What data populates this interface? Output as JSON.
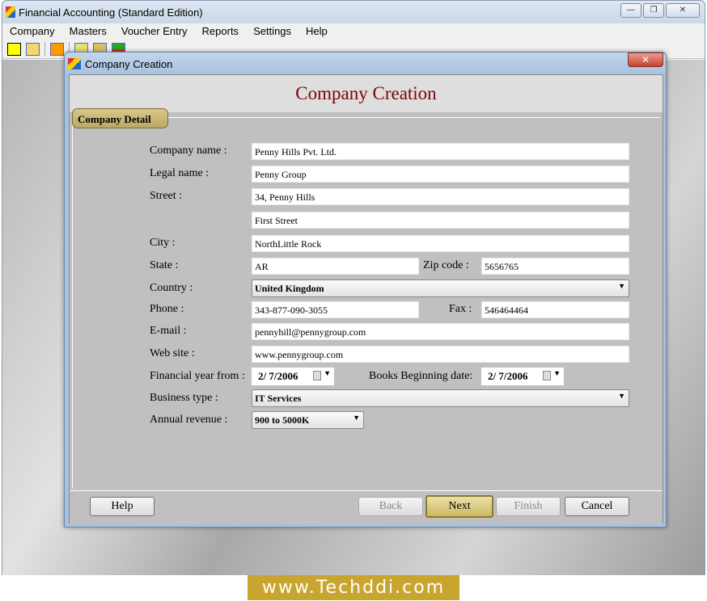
{
  "app": {
    "title": "Financial Accounting (Standard Edition)",
    "menu": [
      "Company",
      "Masters",
      "Voucher Entry",
      "Reports",
      "Settings",
      "Help"
    ],
    "toolbar_icons": [
      "new-icon",
      "open-icon",
      "calendar-grid-icon",
      "balance-icon",
      "notepad-icon",
      "add-remove-icon"
    ]
  },
  "dialog": {
    "title": "Company Creation",
    "header": "Company Creation",
    "group": "Company Detail",
    "fields": {
      "company_name": {
        "label": "Company name :",
        "value": "Penny Hills Pvt. Ltd."
      },
      "legal_name": {
        "label": "Legal name :",
        "value": "Penny Group"
      },
      "street": {
        "label": "Street :",
        "value": "34, Penny Hills",
        "value2": "First Street"
      },
      "city": {
        "label": "City :",
        "value": "NorthLittle Rock"
      },
      "state": {
        "label": "State :",
        "value": "AR"
      },
      "zip": {
        "label": "Zip code :",
        "value": "5656765"
      },
      "country": {
        "label": "Country :",
        "value": "United Kingdom"
      },
      "phone": {
        "label": "Phone :",
        "value": "343-877-090-3055"
      },
      "fax": {
        "label": "Fax :",
        "value": "546464464"
      },
      "email": {
        "label": "E-mail :",
        "value": "pennyhill@pennygroup.com"
      },
      "website": {
        "label": "Web site :",
        "value": "www.pennygroup.com"
      },
      "fy_from": {
        "label": "Financial year from :",
        "value": "2/  7/2006"
      },
      "books_begin": {
        "label": "Books Beginning date:",
        "value": "2/  7/2006"
      },
      "business_type": {
        "label": "Business type :",
        "value": "IT Services"
      },
      "annual_revenue": {
        "label": "Annual revenue :",
        "value": "900 to 5000K"
      }
    },
    "buttons": {
      "help": "Help",
      "back": "Back",
      "next": "Next",
      "finish": "Finish",
      "cancel": "Cancel"
    }
  },
  "watermark": "www.Techddi.com"
}
